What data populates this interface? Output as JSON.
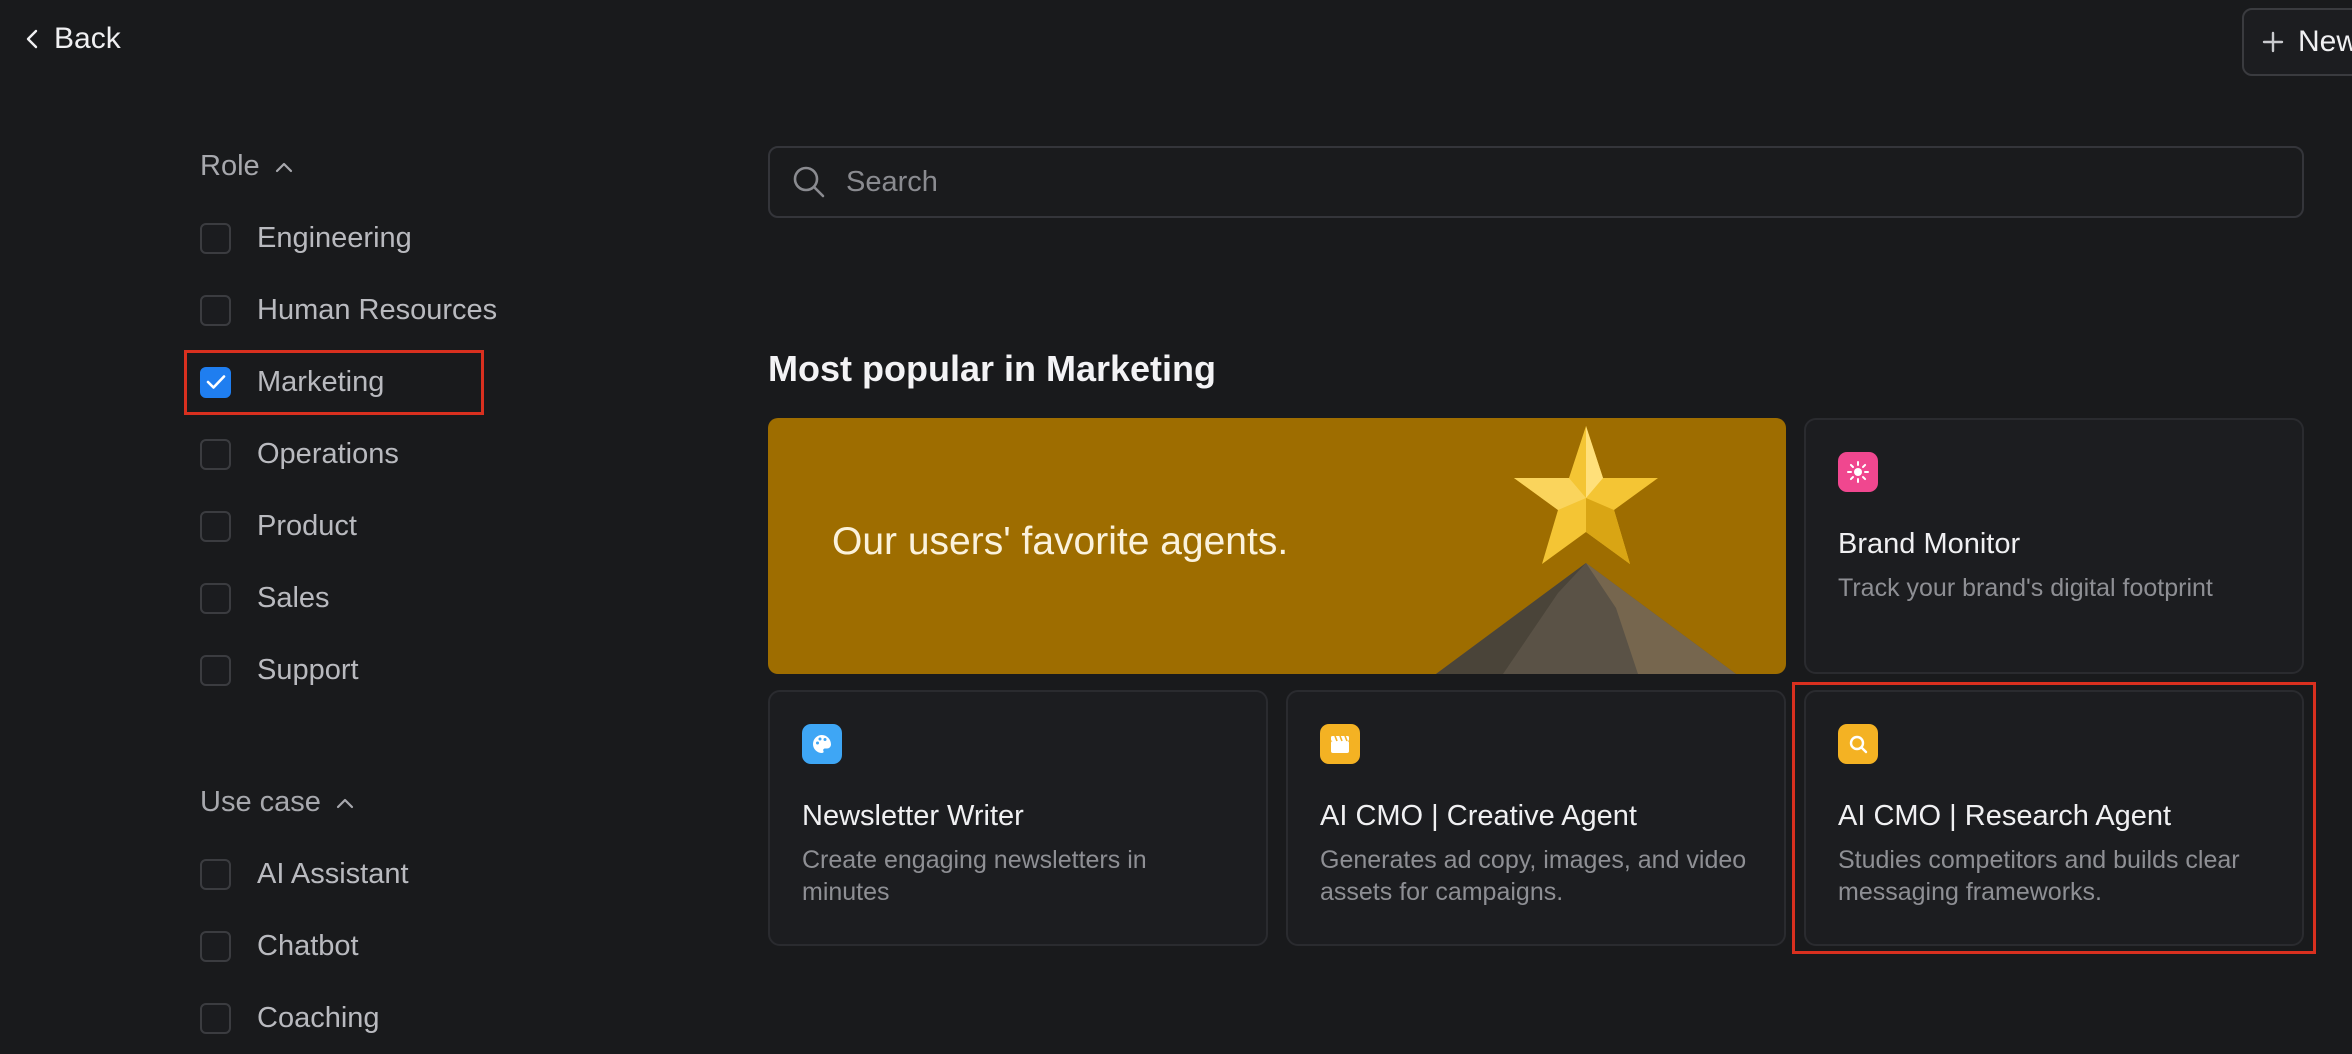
{
  "header": {
    "back_label": "Back",
    "new_label": "New"
  },
  "filters": {
    "role": {
      "heading": "Role",
      "options": [
        {
          "label": "Engineering",
          "checked": false
        },
        {
          "label": "Human Resources",
          "checked": false
        },
        {
          "label": "Marketing",
          "checked": true
        },
        {
          "label": "Operations",
          "checked": false
        },
        {
          "label": "Product",
          "checked": false
        },
        {
          "label": "Sales",
          "checked": false
        },
        {
          "label": "Support",
          "checked": false
        }
      ]
    },
    "use_case": {
      "heading": "Use case",
      "options": [
        {
          "label": "AI Assistant",
          "checked": false
        },
        {
          "label": "Chatbot",
          "checked": false
        },
        {
          "label": "Coaching",
          "checked": false
        }
      ]
    }
  },
  "search": {
    "placeholder": "Search",
    "value": ""
  },
  "main": {
    "section_title": "Most popular in Marketing",
    "banner": {
      "text": "Our users' favorite agents."
    },
    "cards": [
      {
        "title": "Brand Monitor",
        "description": "Track your brand's digital footprint",
        "icon": "sun-icon",
        "icon_color": "#f0478f"
      },
      {
        "title": "Newsletter Writer",
        "description": "Create engaging newsletters in minutes",
        "icon": "palette-icon",
        "icon_color": "#3ea6f5"
      },
      {
        "title": "AI CMO | Creative Agent",
        "description": "Generates ad copy, images, and video assets for campaigns.",
        "icon": "clapperboard-icon",
        "icon_color": "#f4b223"
      },
      {
        "title": "AI CMO | Research Agent",
        "description": "Studies competitors and builds clear messaging frameworks.",
        "icon": "magnifier-icon",
        "icon_color": "#f4b223"
      }
    ]
  },
  "colors": {
    "background": "#191a1c",
    "accent": "#1f7ef0",
    "banner": "#9e6d00",
    "highlight": "#d9301f"
  }
}
